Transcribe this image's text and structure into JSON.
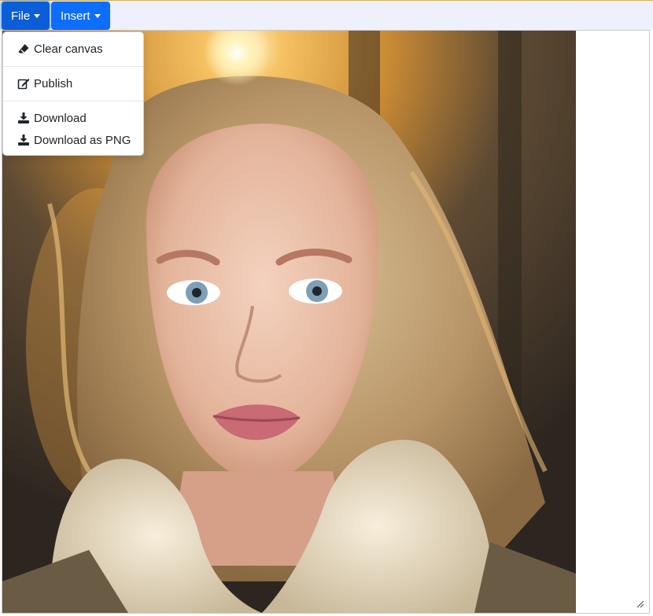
{
  "toolbar": {
    "file_label": "File",
    "insert_label": "Insert"
  },
  "file_menu": {
    "items": [
      {
        "label": "Clear canvas",
        "icon": "eraser-icon"
      },
      {
        "label": "Publish",
        "icon": "edit-icon"
      },
      {
        "label": "Download",
        "icon": "download-icon"
      },
      {
        "label": "Download as PNG",
        "icon": "download-icon"
      }
    ]
  },
  "canvas": {
    "image_subject": "portrait-photo"
  },
  "colors": {
    "primary": "#0d6efd",
    "toolbar_bg": "#eef0fb",
    "menu_text": "#212529"
  }
}
